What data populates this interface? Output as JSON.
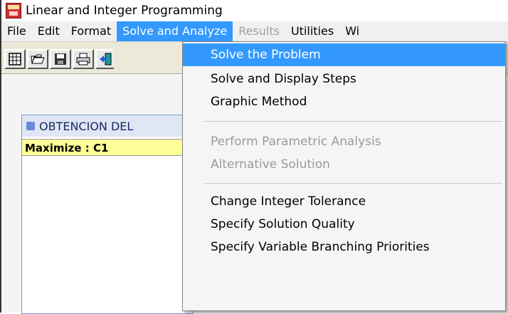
{
  "window": {
    "title": "Linear and Integer Programming"
  },
  "menubar": {
    "items": [
      {
        "label": "File"
      },
      {
        "label": "Edit"
      },
      {
        "label": "Format"
      },
      {
        "label": "Solve and Analyze"
      },
      {
        "label": "Results"
      },
      {
        "label": "Utilities"
      },
      {
        "label": "Wi"
      }
    ]
  },
  "toolbar": {
    "buttons": [
      {
        "icon": "new-table-icon"
      },
      {
        "icon": "open-folder-icon"
      },
      {
        "icon": "save-disk-icon"
      },
      {
        "icon": "print-icon"
      },
      {
        "icon": "exit-door-icon"
      }
    ]
  },
  "document": {
    "title": "OBTENCION DEL",
    "objective": "Maximize : C1"
  },
  "dropdown": {
    "items": [
      {
        "label": "Solve the Problem",
        "state": "highlighted"
      },
      {
        "label": "Solve and Display Steps",
        "state": "enabled"
      },
      {
        "label": "Graphic Method",
        "state": "enabled"
      },
      {
        "label": "Perform Parametric Analysis",
        "state": "disabled"
      },
      {
        "label": "Alternative Solution",
        "state": "disabled"
      },
      {
        "label": "Change Integer Tolerance",
        "state": "enabled"
      },
      {
        "label": "Specify Solution Quality",
        "state": "enabled"
      },
      {
        "label": "Specify Variable Branching Priorities",
        "state": "enabled"
      }
    ]
  },
  "colors": {
    "highlight": "#3399ff",
    "objective_row": "#ffff99",
    "disabled_text": "#a0a0a0"
  }
}
